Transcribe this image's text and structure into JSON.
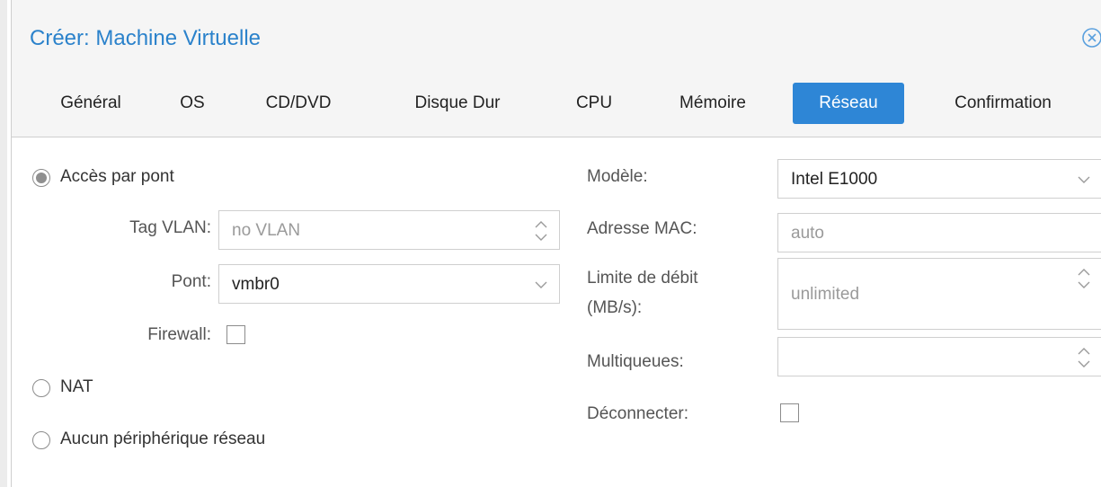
{
  "dialog": {
    "title": "Créer: Machine Virtuelle",
    "close_icon": "close-circle-icon"
  },
  "tabs": [
    {
      "label": "Général"
    },
    {
      "label": "OS"
    },
    {
      "label": "CD/DVD"
    },
    {
      "label": "Disque Dur"
    },
    {
      "label": "CPU"
    },
    {
      "label": "Mémoire"
    },
    {
      "label": "Réseau",
      "active": true
    },
    {
      "label": "Confirmation"
    }
  ],
  "network_mode": {
    "bridge": {
      "label": "Accès par pont",
      "selected": true,
      "vlan_tag": {
        "label": "Tag VLAN:",
        "placeholder": "no VLAN"
      },
      "bridge_select": {
        "label": "Pont:",
        "value": "vmbr0"
      },
      "firewall": {
        "label": "Firewall:",
        "checked": false
      }
    },
    "nat": {
      "label": "NAT",
      "selected": false
    },
    "none": {
      "label": "Aucun périphérique réseau",
      "selected": false
    }
  },
  "device": {
    "model": {
      "label": "Modèle:",
      "value": "Intel E1000"
    },
    "mac": {
      "label": "Adresse MAC:",
      "placeholder": "auto"
    },
    "rate_limit": {
      "label_line1": "Limite de débit",
      "label_line2": "(MB/s):",
      "placeholder": "unlimited"
    },
    "multiqueue": {
      "label": "Multiqueues:",
      "value": ""
    },
    "disconnect": {
      "label": "Déconnecter:",
      "checked": false
    }
  },
  "colors": {
    "accent": "#2e86d6",
    "title": "#2b82cb",
    "header_bg": "#f5f5f5"
  }
}
